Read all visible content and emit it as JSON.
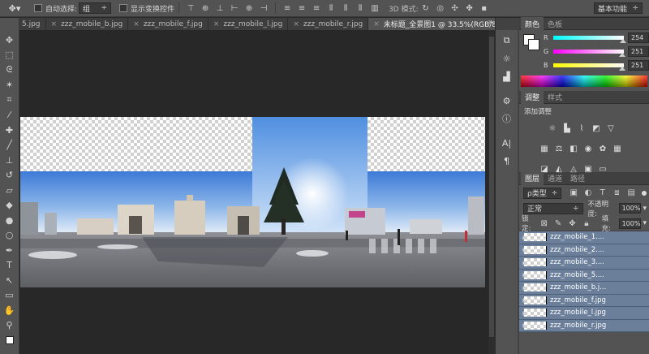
{
  "options_bar": {
    "auto_select_label": "自动选择:",
    "auto_select_value": "组",
    "show_transform_label": "显示变换控件",
    "mode_3d_label": "3D 模式:",
    "workspace": "基本功能"
  },
  "tabs": [
    {
      "label": "5.jpg"
    },
    {
      "label": "zzz_mobile_b.jpg"
    },
    {
      "label": "zzz_mobile_f.jpg"
    },
    {
      "label": "zzz_mobile_l.jpg"
    },
    {
      "label": "zzz_mobile_r.jpg"
    },
    {
      "label": "未标题_全景图1 @ 33.5%(RGB/8#) *"
    }
  ],
  "color_panel": {
    "tabs": [
      "颜色",
      "色板"
    ],
    "r_label": "R",
    "g_label": "G",
    "b_label": "B",
    "r": "254",
    "g": "251",
    "b": "251"
  },
  "adjust_panel": {
    "tabs": [
      "调整",
      "样式"
    ],
    "add_label": "添加调整"
  },
  "layers_panel": {
    "tabs": [
      "图层",
      "通道",
      "路径"
    ],
    "filter_kind": "ρ类型",
    "blend_mode": "正常",
    "opacity_label": "不透明度:",
    "opacity": "100%",
    "lock_label": "锁定:",
    "fill_label": "填充:",
    "fill": "100%",
    "layers": [
      {
        "name": "zzz_mobile_1...."
      },
      {
        "name": "zzz_mobile_2...."
      },
      {
        "name": "zzz_mobile_3...."
      },
      {
        "name": "zzz_mobile_5...."
      },
      {
        "name": "zzz_mobile_b.j..."
      },
      {
        "name": "zzz_mobile_f.jpg"
      },
      {
        "name": "zzz_mobile_l.jpg"
      },
      {
        "name": "zzz_mobile_r.jpg"
      }
    ]
  }
}
